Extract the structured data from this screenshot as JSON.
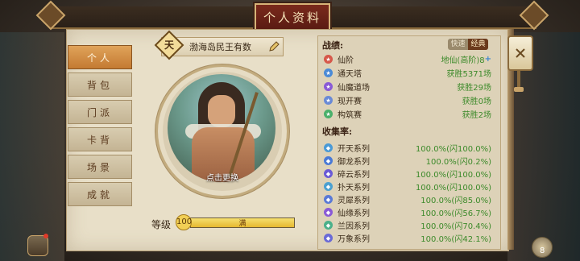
{
  "window": {
    "title": "个人资料"
  },
  "nav": {
    "items": [
      {
        "label": "个人",
        "active": true
      },
      {
        "label": "背包",
        "active": false
      },
      {
        "label": "门派",
        "active": false
      },
      {
        "label": "卡背",
        "active": false
      },
      {
        "label": "场景",
        "active": false
      },
      {
        "label": "成就",
        "active": false
      }
    ]
  },
  "profile": {
    "badge": "天",
    "name": "渤海岛民王有数",
    "avatar_action": "点击更换",
    "level_label": "等级",
    "level": "100",
    "level_bar_text": "满",
    "level_progress": 1.0
  },
  "record": {
    "heading": "战绩:",
    "toggle": [
      "快速",
      "经典"
    ],
    "rows": [
      {
        "label": "仙阶",
        "value": "地仙(高阶)8",
        "icon": "star-icon",
        "color": "#d6584a"
      },
      {
        "label": "通天塔",
        "value": "获胜5371场",
        "icon": "tower-icon",
        "color": "#4a8ad6"
      },
      {
        "label": "仙魔道场",
        "value": "获胜29场",
        "icon": "arena-icon",
        "color": "#8a5ad6"
      },
      {
        "label": "现开赛",
        "value": "获胜0场",
        "icon": "match-icon",
        "color": "#6a8ad6"
      },
      {
        "label": "构筑赛",
        "value": "获胜2场",
        "icon": "build-icon",
        "color": "#4ab06a"
      }
    ]
  },
  "collection": {
    "heading": "收集率:",
    "rows": [
      {
        "label": "开天系列",
        "value": "100.0%(闪100.0%)",
        "color": "#4a9ad6"
      },
      {
        "label": "御龙系列",
        "value": "100.0%(闪0.2%)",
        "color": "#4a7ad6"
      },
      {
        "label": "碎云系列",
        "value": "100.0%(闪100.0%)",
        "color": "#6a5ad6"
      },
      {
        "label": "扑天系列",
        "value": "100.0%(闪100.0%)",
        "color": "#4aa0d0"
      },
      {
        "label": "灵犀系列",
        "value": "100.0%(闪85.0%)",
        "color": "#5a7ad6"
      },
      {
        "label": "仙缘系列",
        "value": "100.0%(闪56.7%)",
        "color": "#8a5ad6"
      },
      {
        "label": "兰因系列",
        "value": "100.0%(闪70.4%)",
        "color": "#4ab08a"
      },
      {
        "label": "万象系列",
        "value": "100.0%(闪42.1%)",
        "color": "#6a6ad6"
      }
    ]
  },
  "corner": {
    "count": "8"
  },
  "colors": {
    "accent": "#c47a32",
    "value_green": "#3c8a2a",
    "title_red": "#7a2a1c"
  }
}
